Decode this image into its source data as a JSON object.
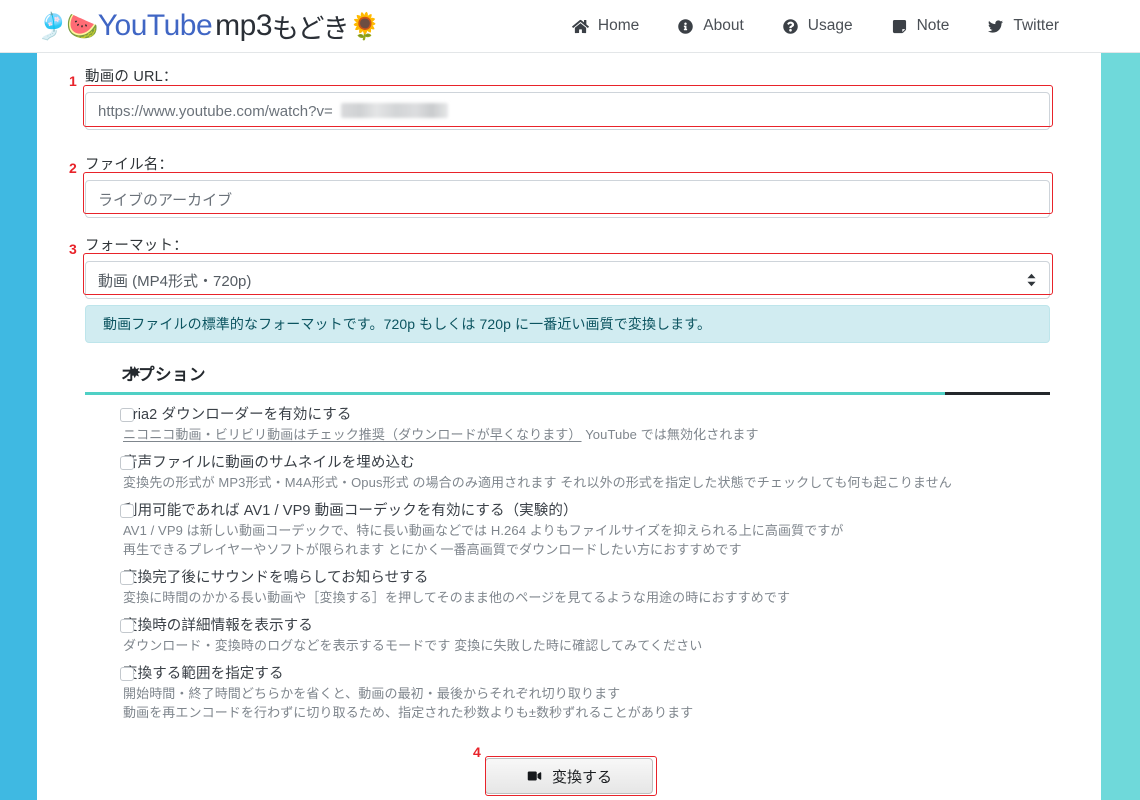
{
  "header": {
    "brand": {
      "emoji_left": "🎐🍉",
      "youtube": "YouTube",
      "mp3": "mp3",
      "japanese": "もどき",
      "emoji_right": "🌻"
    },
    "nav": [
      {
        "label": "Home",
        "icon": "home-icon"
      },
      {
        "label": "About",
        "icon": "info-circle-icon"
      },
      {
        "label": "Usage",
        "icon": "question-circle-icon"
      },
      {
        "label": "Note",
        "icon": "sticky-note-icon"
      },
      {
        "label": "Twitter",
        "icon": "twitter-bird-icon"
      }
    ]
  },
  "form": {
    "url": {
      "label": "動画の URL：",
      "value": "https://www.youtube.com/watch?v=",
      "annotation": "1"
    },
    "filename": {
      "label": "ファイル名：",
      "value": "ライブのアーカイブ",
      "annotation": "2"
    },
    "format": {
      "label": "フォーマット：",
      "value": "動画 (MP4形式・720p)",
      "annotation": "3",
      "options": [
        "動画 (MP4形式・720p)"
      ]
    },
    "info_note": "動画ファイルの標準的なフォーマットです。720p もしくは 720p に一番近い画質で変換します。"
  },
  "options": {
    "title": "オプション",
    "gear_icon": "gear-icon",
    "items": [
      {
        "label": "Aria2 ダウンローダーを有効にする",
        "sub_underlined": "ニコニコ動画・ビリビリ動画はチェック推奨（ダウンロードが早くなります）",
        "sub_plain": " YouTube では無効化されます",
        "checked": false
      },
      {
        "label": "音声ファイルに動画のサムネイルを埋め込む",
        "sub_plain": "変換先の形式が MP3形式・M4A形式・Opus形式 の場合のみ適用されます それ以外の形式を指定した状態でチェックしても何も起こりません",
        "checked": false
      },
      {
        "label": "利用可能であれば AV1 / VP9 動画コーデックを有効にする（実験的）",
        "sub_plain": "AV1 / VP9 は新しい動画コーデックで、特に長い動画などでは H.264 よりもファイルサイズを抑えられる上に高画質ですが",
        "sub_plain2": "再生できるプレイヤーやソフトが限られます とにかく一番高画質でダウンロードしたい方におすすめです",
        "checked": false
      },
      {
        "label": "変換完了後にサウンドを鳴らしてお知らせする",
        "sub_plain": "変換に時間のかかる長い動画や［変換する］を押してそのまま他のページを見てるような用途の時におすすめです",
        "checked": false
      },
      {
        "label": "変換時の詳細情報を表示する",
        "sub_plain": "ダウンロード・変換時のログなどを表示するモードです 変換に失敗した時に確認してみてください",
        "checked": false
      },
      {
        "label": "変換する範囲を指定する",
        "sub_plain": "開始時間・終了時間どちらかを省くと、動画の最初・最後からそれぞれ切り取ります",
        "sub_plain2": "動画を再エンコードを行わずに切り取るため、指定された秒数よりも±数秒ずれることがあります",
        "checked": false
      }
    ]
  },
  "submit": {
    "label": "変換する",
    "icon": "video-camera-icon",
    "annotation": "4"
  },
  "colors": {
    "band_left": "#3fb9e2",
    "band_right": "#6fd9da",
    "accent_teal": "#4fd0c5",
    "annotation_red": "#e8232a",
    "brand_blue": "#4066c4",
    "info_bg": "#d1ecf1",
    "info_text": "#0c5460"
  }
}
